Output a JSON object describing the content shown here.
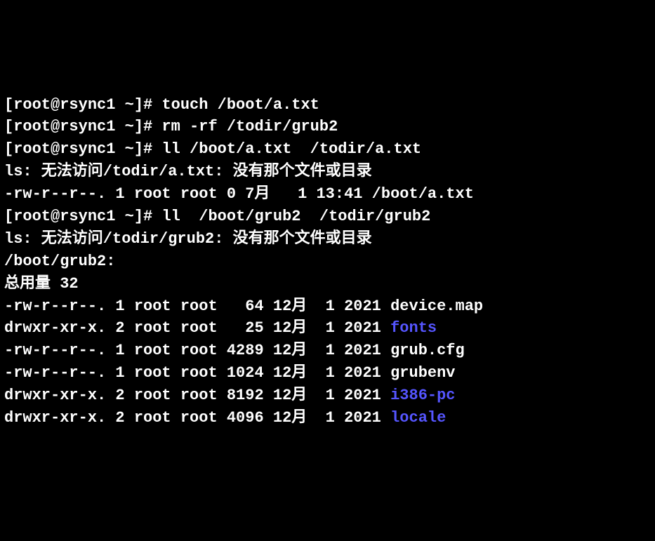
{
  "lines": [
    {
      "prompt": "[root@rsync1 ~]# ",
      "command": "touch /boot/a.txt"
    },
    {
      "prompt": "[root@rsync1 ~]# ",
      "command": "rm -rf /todir/grub2"
    },
    {
      "prompt": "[root@rsync1 ~]# ",
      "command": "ll /boot/a.txt  /todir/a.txt"
    },
    {
      "text": "ls: 无法访问/todir/a.txt: 没有那个文件或目录"
    },
    {
      "text": "-rw-r--r--. 1 root root 0 7月   1 13:41 /boot/a.txt"
    },
    {
      "prompt": "[root@rsync1 ~]# ",
      "command": "ll  /boot/grub2  /todir/grub2"
    },
    {
      "text": "ls: 无法访问/todir/grub2: 没有那个文件或目录"
    },
    {
      "text": "/boot/grub2:"
    },
    {
      "text": "总用量 32"
    },
    {
      "text": "-rw-r--r--. 1 root root   64 12月  1 2021 device.map"
    },
    {
      "text": "drwxr-xr-x. 2 root root   25 12月  1 2021 ",
      "dirName": "fonts"
    },
    {
      "text": "-rw-r--r--. 1 root root 4289 12月  1 2021 grub.cfg"
    },
    {
      "text": "-rw-r--r--. 1 root root 1024 12月  1 2021 grubenv"
    },
    {
      "text": "drwxr-xr-x. 2 root root 8192 12月  1 2021 ",
      "dirName": "i386-pc"
    },
    {
      "text": "drwxr-xr-x. 2 root root 4096 12月  1 2021 ",
      "dirName": "locale"
    }
  ]
}
